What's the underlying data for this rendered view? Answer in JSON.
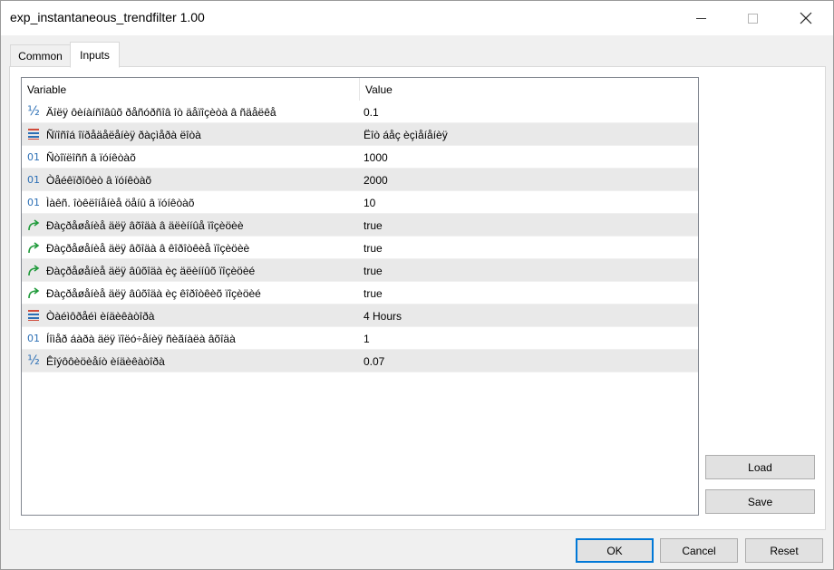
{
  "window": {
    "title": "exp_instantaneous_trendfilter 1.00"
  },
  "tabs": [
    {
      "label": "Common",
      "active": false
    },
    {
      "label": "Inputs",
      "active": true
    }
  ],
  "grid": {
    "headers": {
      "variable": "Variable",
      "value": "Value"
    },
    "rows": [
      {
        "icon": "fraction-icon",
        "variable": "Äîëÿ ôèíàíñîâûõ ðåñóðñîâ îò äåïîçèòà â ñäåëêå",
        "value": "0.1"
      },
      {
        "icon": "enum-icon",
        "variable": "Ñïîñîá îïðåäåëåíèÿ ðàçìåðà ëîòà",
        "value": "Ëîò áåç èçìåíåíèÿ"
      },
      {
        "icon": "integer-icon",
        "variable": "Ñòîïëîññ â ïóíêòàõ",
        "value": "1000"
      },
      {
        "icon": "integer-icon",
        "variable": "Òåéêïðîôèò â ïóíêòàõ",
        "value": "2000"
      },
      {
        "icon": "integer-icon",
        "variable": "Ìàêñ. îòêëîíåíèå öåíû â ïóíêòàõ",
        "value": "10"
      },
      {
        "icon": "bool-icon",
        "variable": "Ðàçðåøåíèå äëÿ âõîäà â äëèííûå ïîçèöèè",
        "value": "true"
      },
      {
        "icon": "bool-icon",
        "variable": "Ðàçðåøåíèå äëÿ âõîäà â êîðîòêèå ïîçèöèè",
        "value": "true"
      },
      {
        "icon": "bool-icon",
        "variable": "Ðàçðåøåíèå äëÿ âûõîäà èç äëèííûõ ïîçèöèé",
        "value": "true"
      },
      {
        "icon": "bool-icon",
        "variable": "Ðàçðåøåíèå äëÿ âûõîäà èç êîðîòêèõ ïîçèöèé",
        "value": "true"
      },
      {
        "icon": "enum-icon",
        "variable": "Òàéìôðåéì èíäèêàòîðà",
        "value": "4 Hours"
      },
      {
        "icon": "integer-icon",
        "variable": "Íîìåð áàðà äëÿ ïîëó÷åíèÿ ñèãíàëà âõîäà",
        "value": "1"
      },
      {
        "icon": "fraction-icon",
        "variable": "Êîýôôèöèåíò èíäèêàòîðà",
        "value": "0.07"
      }
    ]
  },
  "buttons": {
    "load": "Load",
    "save": "Save",
    "ok": "OK",
    "cancel": "Cancel",
    "reset": "Reset"
  },
  "icon_glyphs": {
    "fraction-icon": "½",
    "integer-icon": "01"
  },
  "colors": {
    "accent": "#0078d7",
    "row_alt": "#e9e9e9",
    "icon_blue": "#2c6fb5",
    "icon_green": "#1f9a3a"
  }
}
